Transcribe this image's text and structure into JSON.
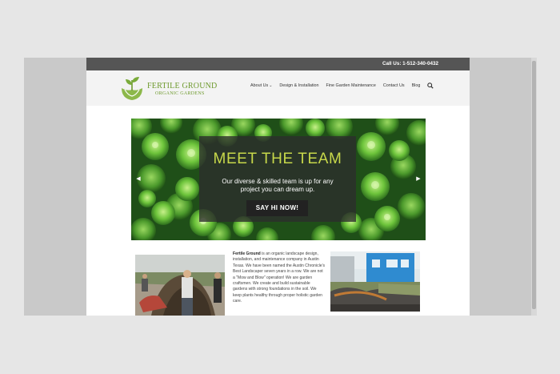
{
  "topbar": {
    "phone": "Call Us: 1-512-340-0432"
  },
  "logo": {
    "title": "FERTILE GROUND",
    "subtitle": "ORGANIC GARDENS"
  },
  "nav": {
    "items": [
      {
        "label": "About Us",
        "has_dropdown": true
      },
      {
        "label": "Design & Installation"
      },
      {
        "label": "Fine Garden Maintenance"
      },
      {
        "label": "Contact Us"
      },
      {
        "label": "Blog"
      }
    ],
    "search_icon": "search-icon"
  },
  "hero": {
    "title": "MEET THE TEAM",
    "text": "Our diverse & skilled team is up for any project you can dream up.",
    "cta": "SAY HI NOW!",
    "prev_icon": "chevron-left-icon",
    "next_icon": "chevron-right-icon"
  },
  "intro": {
    "brand": "Fertile Ground",
    "text": " is an organic landscape design, installation, and maintenance company in Austin Texas. We have been named the Austin Chronicle's Best Landscaper seven years in a row. We are not a \"Mow and Blow\" operation! We are garden craftsmen. We create and build sustainable gardens with strong foundations in the soil. We keep plants healthy through proper holistic garden care."
  },
  "colors": {
    "background": "#e6e6e6",
    "topbar": "#555555",
    "header": "#f3f3f3",
    "brand_green": "#6e9a2e",
    "hero_title": "#c7d84a",
    "cta_bg": "#222222"
  }
}
